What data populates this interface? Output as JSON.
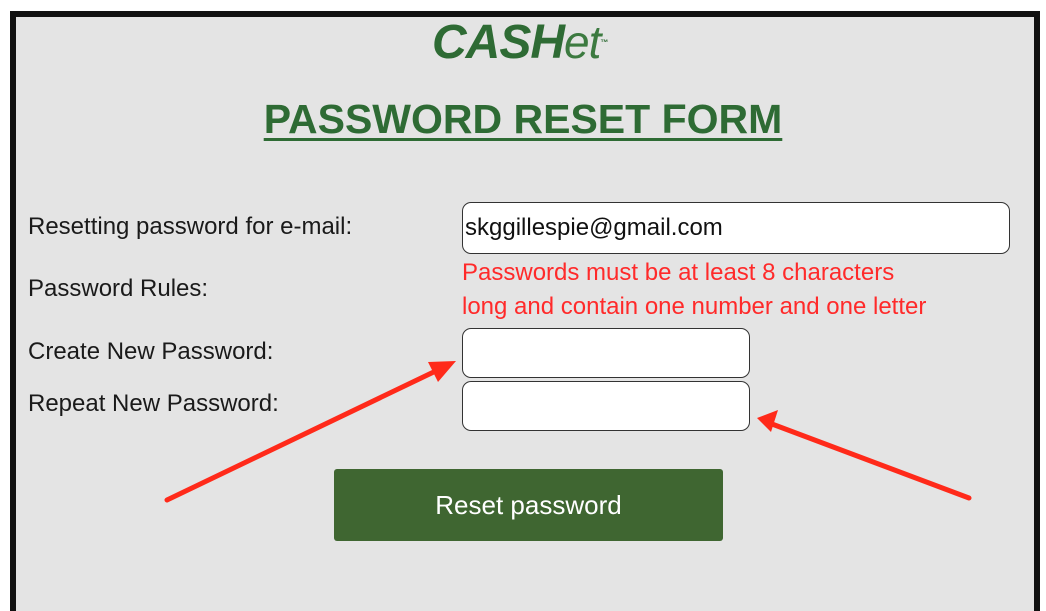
{
  "logo": {
    "main": "CASH",
    "tail": "et",
    "tm": "™"
  },
  "form": {
    "title": "PASSWORD RESET FORM",
    "email_label": "Resetting password for e-mail:",
    "email_value": "skggillespie@gmail.com",
    "rules_label": "Password Rules:",
    "rules_line1": "Passwords must be at least 8 characters",
    "rules_line2": "long and contain one number and one letter",
    "new_password_label": "Create New Password:",
    "new_password_value": "",
    "repeat_password_label": "Repeat New Password:",
    "repeat_password_value": "",
    "submit_label": "Reset password"
  },
  "annotations": {
    "arrow_color": "#ff2a1a",
    "arrows": [
      "red-arrow-icon",
      "red-arrow-icon"
    ]
  },
  "colors": {
    "brand_green": "#2e6b34",
    "button_green": "#3f6631",
    "rules_red": "#ff2a2a",
    "panel_bg": "#e4e4e4"
  }
}
